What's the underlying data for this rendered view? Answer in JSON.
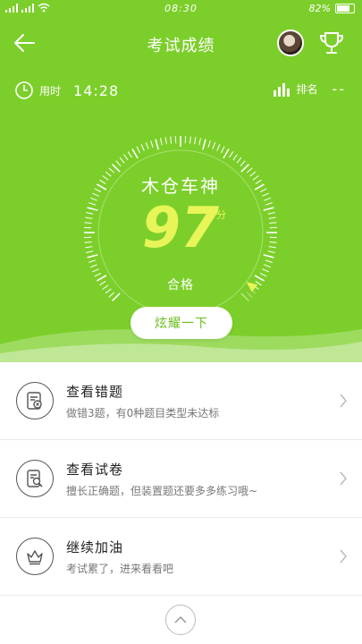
{
  "status_bar": {
    "time": "08:30",
    "battery": "82%"
  },
  "header": {
    "title": "考试成绩"
  },
  "info": {
    "time_label": "用时",
    "time_value": "14:28",
    "rank_label": "排名",
    "rank_value": "--"
  },
  "result": {
    "title": "木仓车神",
    "score": "97",
    "unit": "分",
    "status": "合格",
    "progress": 0.97
  },
  "actions": {
    "show_off": "炫耀一下"
  },
  "list": [
    {
      "title": "查看错题",
      "subtitle": "做错3题，有0种题目类型未达标",
      "icon": "wrong-questions-icon"
    },
    {
      "title": "查看试卷",
      "subtitle": "擅长正确题，但装置题还要多多练习哦~",
      "icon": "view-paper-icon"
    },
    {
      "title": "继续加油",
      "subtitle": "考试累了，进来看看吧",
      "icon": "crown-icon"
    }
  ],
  "colors": {
    "accent": "#7ccf2a",
    "score": "#e8f559"
  }
}
